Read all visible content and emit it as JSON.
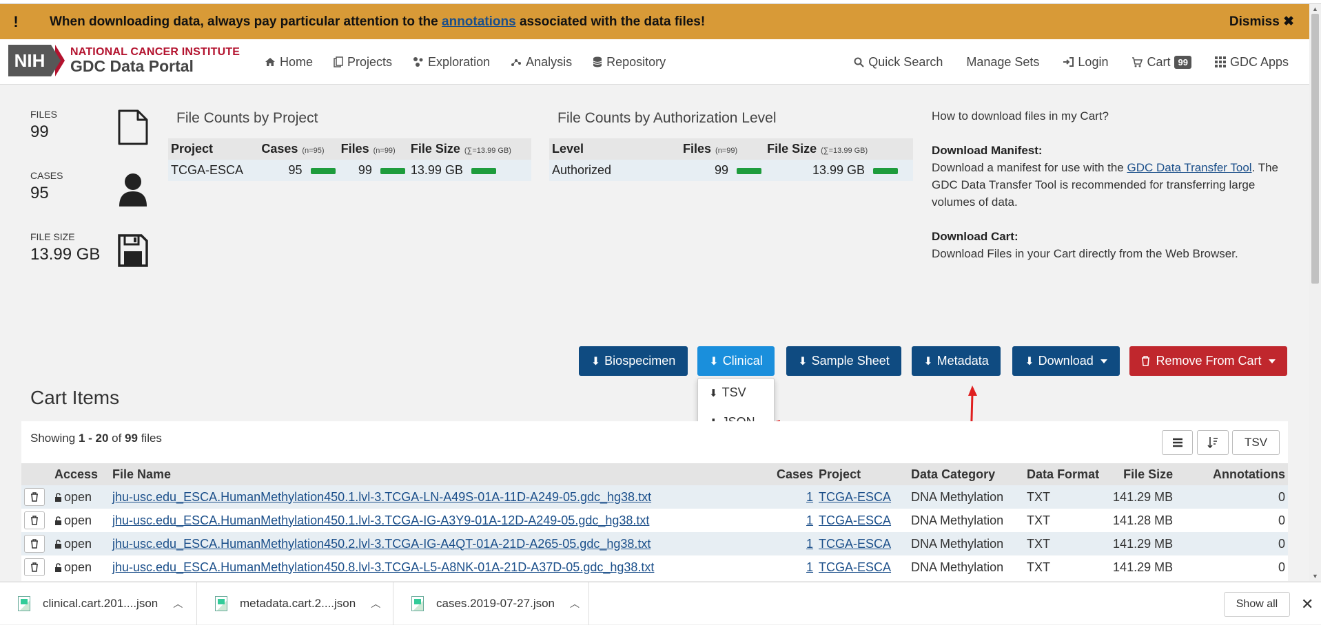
{
  "banner": {
    "icon": "!",
    "text_before": "When downloading data, always pay particular attention to the ",
    "link": "annotations",
    "text_after": " associated with the data files!",
    "dismiss": "Dismiss ✖"
  },
  "header": {
    "logo_nih": "NIH",
    "logo_nci": "NATIONAL CANCER INSTITUTE",
    "logo_gdc": "GDC Data Portal",
    "nav_left": [
      "Home",
      "Projects",
      "Exploration",
      "Analysis",
      "Repository"
    ],
    "nav_right": {
      "quick_search": "Quick Search",
      "manage_sets": "Manage Sets",
      "login": "Login",
      "cart": "Cart",
      "cart_count": "99",
      "gdc_apps": "GDC Apps"
    }
  },
  "summary": {
    "files_label": "FILES",
    "files_value": "99",
    "cases_label": "CASES",
    "cases_value": "95",
    "size_label": "FILE SIZE",
    "size_value": "13.99 GB"
  },
  "project_table": {
    "title": "File Counts by Project",
    "headers": {
      "project": "Project",
      "cases": "Cases",
      "cases_sub": "(n=95)",
      "files": "Files",
      "files_sub": "(n=99)",
      "size": "File Size",
      "size_sub": "(∑=13.99 GB)"
    },
    "row": {
      "project": "TCGA-ESCA",
      "cases": "95",
      "files": "99",
      "size": "13.99 GB"
    }
  },
  "auth_table": {
    "title": "File Counts by Authorization Level",
    "headers": {
      "level": "Level",
      "files": "Files",
      "files_sub": "(n=99)",
      "size": "File Size",
      "size_sub": "(∑=13.99 GB)"
    },
    "row": {
      "level": "Authorized",
      "files": "99",
      "size": "13.99 GB"
    }
  },
  "howto": {
    "question": "How to download files in my Cart?",
    "manifest_title": "Download Manifest:",
    "manifest_text_1": "Download a manifest for use with the ",
    "manifest_link": "GDC Data Transfer Tool",
    "manifest_text_2": ". The GDC Data Transfer Tool is recommended for transferring large volumes of data.",
    "cart_title": "Download Cart:",
    "cart_text": "Download Files in your Cart directly from the Web Browser."
  },
  "buttons": {
    "biospecimen": "Biospecimen",
    "clinical": "Clinical",
    "sample_sheet": "Sample Sheet",
    "metadata": "Metadata",
    "download": "Download",
    "remove": "Remove From Cart"
  },
  "clinical_menu": [
    "TSV",
    "JSON"
  ],
  "cart_items": {
    "title": "Cart Items",
    "showing_prefix": "Showing ",
    "showing_range": "1 - 20",
    "showing_of": " of ",
    "showing_total": "99",
    "showing_suffix": " files",
    "tsv_button": "TSV",
    "columns": [
      "Access",
      "File Name",
      "Cases",
      "Project",
      "Data Category",
      "Data Format",
      "File Size",
      "Annotations"
    ],
    "rows": [
      {
        "access": "open",
        "file": "jhu-usc.edu_ESCA.HumanMethylation450.1.lvl-3.TCGA-LN-A49S-01A-11D-A249-05.gdc_hg38.txt",
        "cases": "1",
        "project": "TCGA-ESCA",
        "category": "DNA Methylation",
        "format": "TXT",
        "size": "141.29 MB",
        "annotations": "0"
      },
      {
        "access": "open",
        "file": "jhu-usc.edu_ESCA.HumanMethylation450.1.lvl-3.TCGA-IG-A3Y9-01A-12D-A249-05.gdc_hg38.txt",
        "cases": "1",
        "project": "TCGA-ESCA",
        "category": "DNA Methylation",
        "format": "TXT",
        "size": "141.28 MB",
        "annotations": "0"
      },
      {
        "access": "open",
        "file": "jhu-usc.edu_ESCA.HumanMethylation450.2.lvl-3.TCGA-IG-A4QT-01A-21D-A265-05.gdc_hg38.txt",
        "cases": "1",
        "project": "TCGA-ESCA",
        "category": "DNA Methylation",
        "format": "TXT",
        "size": "141.29 MB",
        "annotations": "0"
      },
      {
        "access": "open",
        "file": "jhu-usc.edu_ESCA.HumanMethylation450.8.lvl-3.TCGA-L5-A8NK-01A-21D-A37D-05.gdc_hg38.txt",
        "cases": "1",
        "project": "TCGA-ESCA",
        "category": "DNA Methylation",
        "format": "TXT",
        "size": "141.29 MB",
        "annotations": "0"
      }
    ]
  },
  "downloads_bar": {
    "items": [
      "clinical.cart.201....json",
      "metadata.cart.2....json",
      "cases.2019-07-27.json"
    ],
    "show_all": "Show all",
    "close": "✕"
  },
  "colors": {
    "banner": "#d89a37",
    "primary_button": "#0f4b81",
    "active_button": "#1a8fdc",
    "danger_button": "#c0272d",
    "bar_green": "#1e9c3c",
    "annotation_arrow": "#e02020"
  },
  "icons": [
    "home-icon",
    "projects-icon",
    "exploration-icon",
    "analysis-icon",
    "repository-icon",
    "search-icon",
    "login-icon",
    "cart-icon",
    "apps-grid-icon",
    "file-icon",
    "user-icon",
    "save-icon",
    "download-icon",
    "trash-icon",
    "unlock-icon",
    "list-icon",
    "sort-icon"
  ]
}
